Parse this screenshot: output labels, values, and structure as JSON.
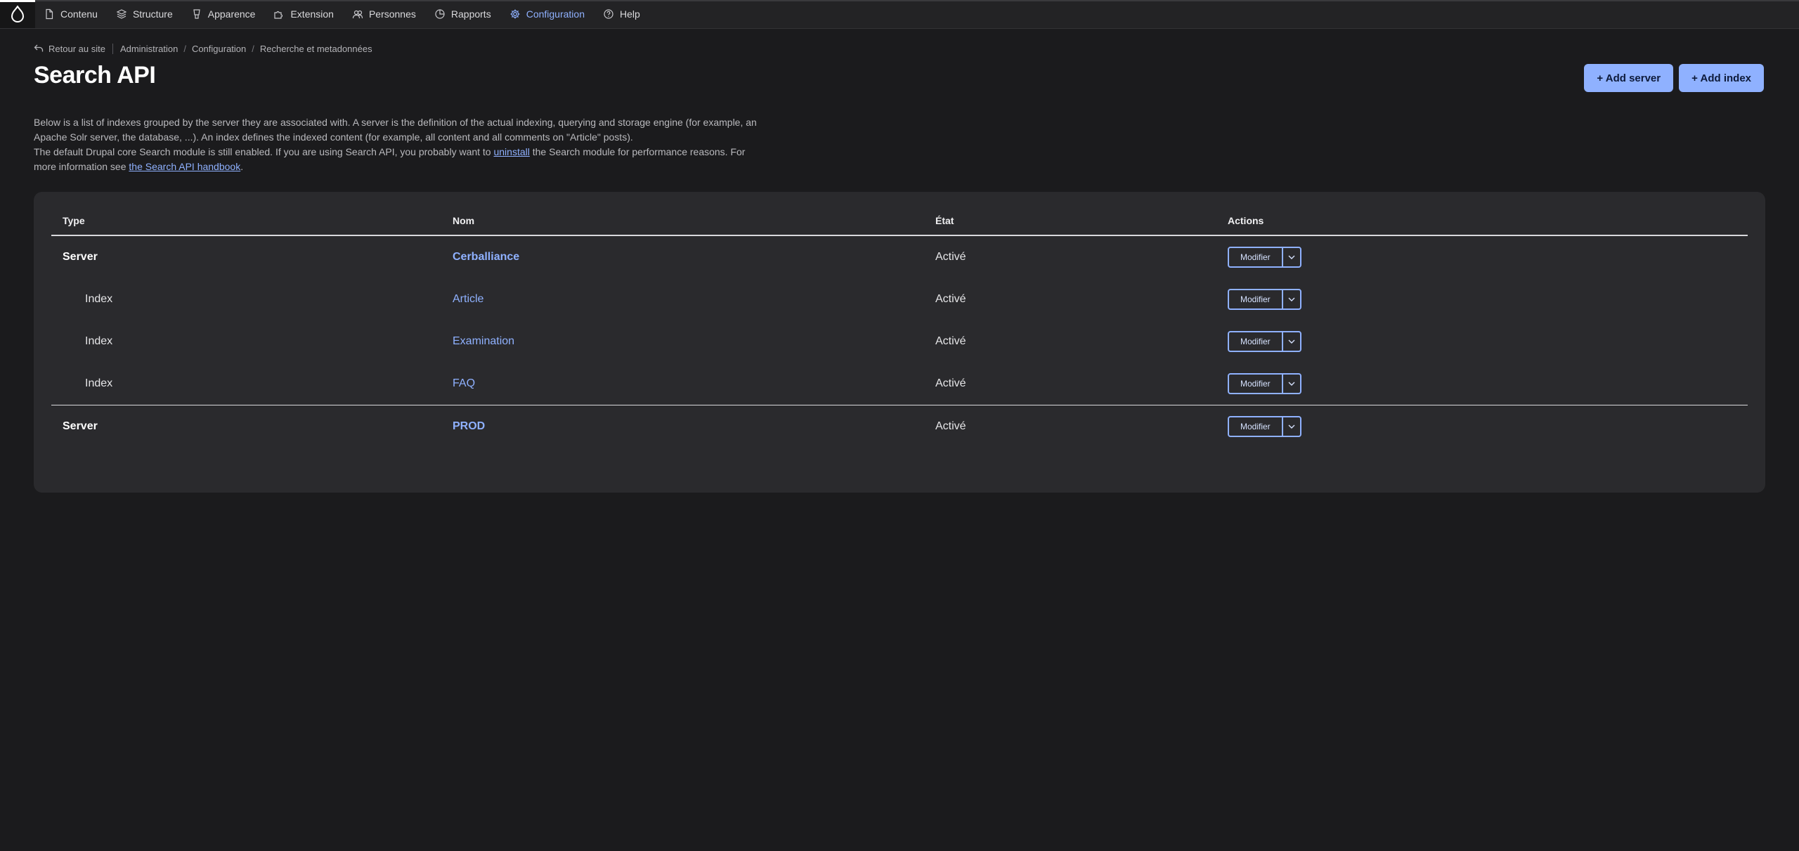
{
  "toolbar": {
    "menu": [
      {
        "label": "Contenu",
        "icon": "file-icon"
      },
      {
        "label": "Structure",
        "icon": "layers-icon"
      },
      {
        "label": "Apparence",
        "icon": "brush-icon"
      },
      {
        "label": "Extension",
        "icon": "puzzle-icon"
      },
      {
        "label": "Personnes",
        "icon": "people-icon"
      },
      {
        "label": "Rapports",
        "icon": "chart-icon"
      },
      {
        "label": "Configuration",
        "icon": "gear-icon",
        "active": true
      },
      {
        "label": "Help",
        "icon": "help-icon"
      }
    ]
  },
  "breadcrumb": {
    "back": "Retour au site",
    "items": [
      "Administration",
      "Configuration",
      "Recherche et metadonnées"
    ]
  },
  "page": {
    "title": "Search API",
    "add_server": "+ Add server",
    "add_index": "+ Add index"
  },
  "description": {
    "p1": "Below is a list of indexes grouped by the server they are associated with. A server is the definition of the actual indexing, querying and storage engine (for example, an Apache Solr server, the database, ...). An index defines the indexed content (for example, all content and all comments on \"Article\" posts).",
    "p2_a": "The default Drupal core Search module is still enabled. If you are using Search API, you probably want to ",
    "p2_link1": "uninstall",
    "p2_b": " the Search module for performance reasons. For more information see ",
    "p2_link2": "the Search API handbook",
    "p2_c": "."
  },
  "table": {
    "headers": {
      "type": "Type",
      "name": "Nom",
      "status": "État",
      "actions": "Actions"
    },
    "rows": [
      {
        "type": "Server",
        "name": "Cerballiance",
        "status": "Activé",
        "action": "Modifier"
      },
      {
        "type": "Index",
        "name": "Article",
        "status": "Activé",
        "action": "Modifier"
      },
      {
        "type": "Index",
        "name": "Examination",
        "status": "Activé",
        "action": "Modifier"
      },
      {
        "type": "Index",
        "name": "FAQ",
        "status": "Activé",
        "action": "Modifier"
      },
      {
        "type": "Server",
        "name": "PROD",
        "status": "Activé",
        "action": "Modifier"
      }
    ]
  },
  "colors": {
    "accent": "#8fb1ff",
    "background": "#1b1b1d",
    "card": "#2a2a2d"
  }
}
